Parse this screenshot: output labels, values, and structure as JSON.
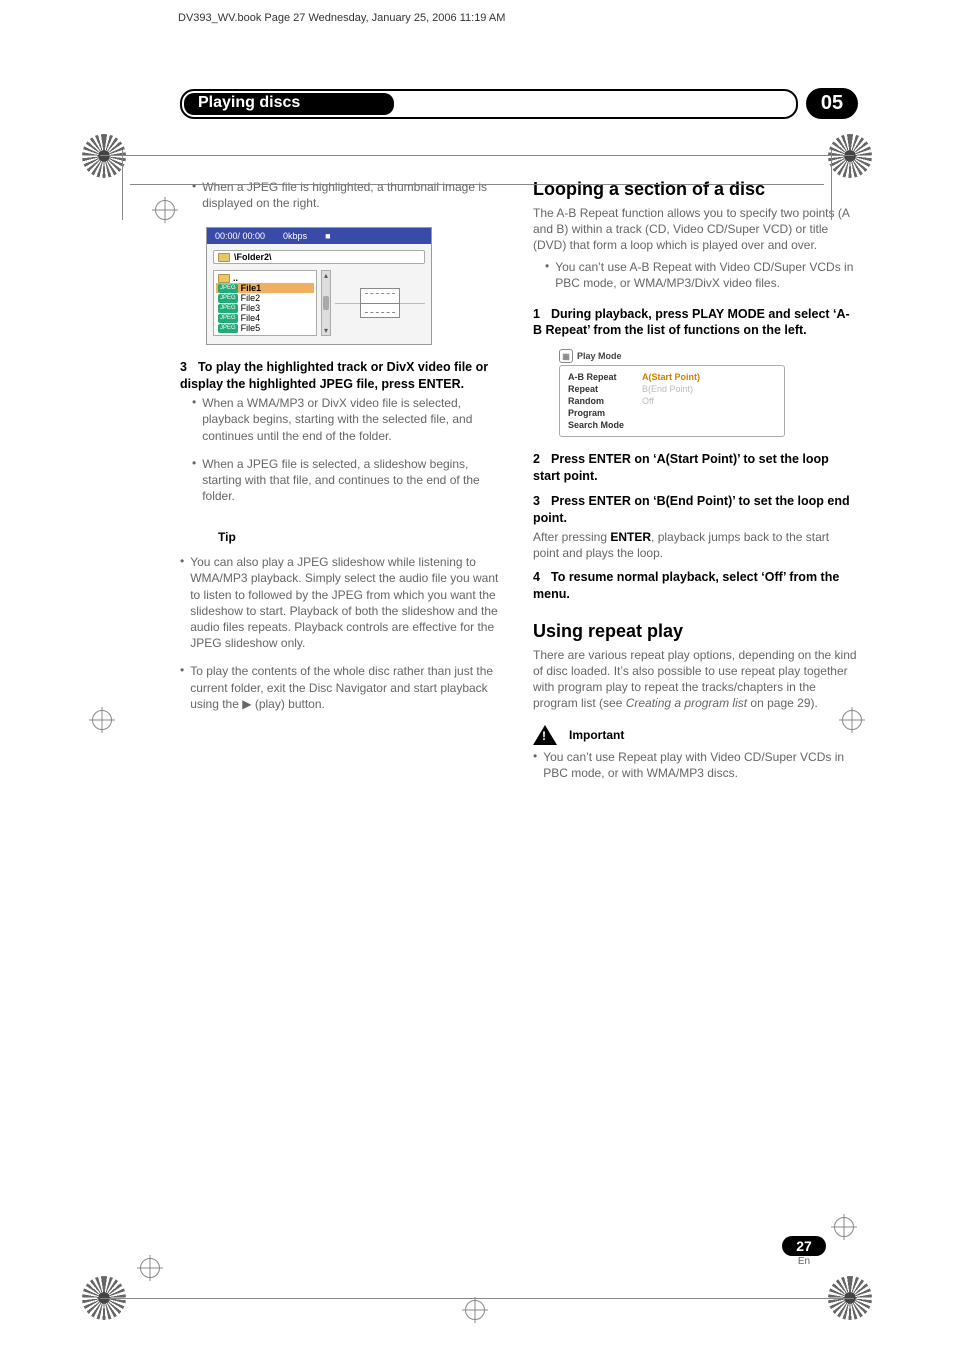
{
  "header": {
    "crop_line": "DV393_WV.book  Page 27  Wednesday, January 25, 2006  11:19 AM"
  },
  "section": {
    "title": "Playing discs",
    "number": "05"
  },
  "left": {
    "jpeg_thumb_note": "When a JPEG file is highlighted, a thumbnail image is displayed on the right.",
    "disc_nav": {
      "time": "00:00/ 00:00",
      "bitrate": "0kbps",
      "stop": "■",
      "path": "\\Folder2\\",
      "dots": "..",
      "chip": "JPEG",
      "files": [
        "File1",
        "File2",
        "File3",
        "File4",
        "File5"
      ]
    },
    "step3": "To play the highlighted track or DivX video file or display the highlighted JPEG file, press ENTER.",
    "step3_b1": "When a WMA/MP3 or DivX video file is selected, playback begins, starting with the selected file, and continues until the end of the folder.",
    "step3_b2": "When a JPEG file is selected, a slideshow begins, starting with that file, and continues to the end of the folder.",
    "tip_label": "Tip",
    "tip_b1": "You can also play a JPEG slideshow while listening to WMA/MP3 playback. Simply select the audio file you want to listen to followed by the JPEG from which you want the slideshow to start. Playback of both the slideshow and the audio files repeats. Playback controls are effective for the JPEG slideshow only.",
    "tip_b2_pre": "To play the contents of the whole disc rather than just the current folder, exit the Disc Navigator and start playback using the ",
    "tip_b2_sym": "▶",
    "tip_b2_post": " (play) button."
  },
  "right": {
    "loop_title": "Looping a section of a disc",
    "loop_desc": "The A-B Repeat function allows you to specify two points (A and B) within a track (CD, Video CD/Super VCD) or title (DVD) that form a loop which is played over and over.",
    "loop_b1": "You can’t use A-B Repeat with Video CD/Super VCDs in PBC mode, or WMA/MP3/DivX video files.",
    "loop_s1": "During playback, press PLAY MODE and select ‘A-B Repeat’ from the list of functions on the left.",
    "play_mode": {
      "title": "Play Mode",
      "left": [
        "A-B Repeat",
        "Repeat",
        "Random",
        "Program",
        "Search Mode"
      ],
      "right": [
        {
          "label": "A(Start Point)",
          "cls": "sel"
        },
        {
          "label": "B(End Point)",
          "cls": "dim"
        },
        {
          "label": "Off",
          "cls": "dim"
        }
      ]
    },
    "loop_s2": "Press ENTER on ‘A(Start Point)’ to set the loop start point.",
    "loop_s3": "Press ENTER on ‘B(End Point)’ to set the loop end point.",
    "loop_s3_after_pre": "After pressing ",
    "loop_s3_after_kw": "ENTER",
    "loop_s3_after_post": ", playback jumps back to the start point and plays the loop.",
    "loop_s4": "To resume normal playback, select ‘Off’ from the menu.",
    "repeat_title": "Using repeat play",
    "repeat_desc_pre": "There are various repeat play options, depending on the kind of disc loaded. It’s also possible to use repeat play together with program play to repeat the tracks/chapters in the program list (see ",
    "repeat_desc_ital": "Creating a program list",
    "repeat_desc_post": " on page 29).",
    "important_label": "Important",
    "imp_b1": "You can’t use Repeat play with Video CD/Super VCDs in PBC mode, or with WMA/MP3 discs."
  },
  "footer": {
    "page": "27",
    "lang": "En"
  }
}
